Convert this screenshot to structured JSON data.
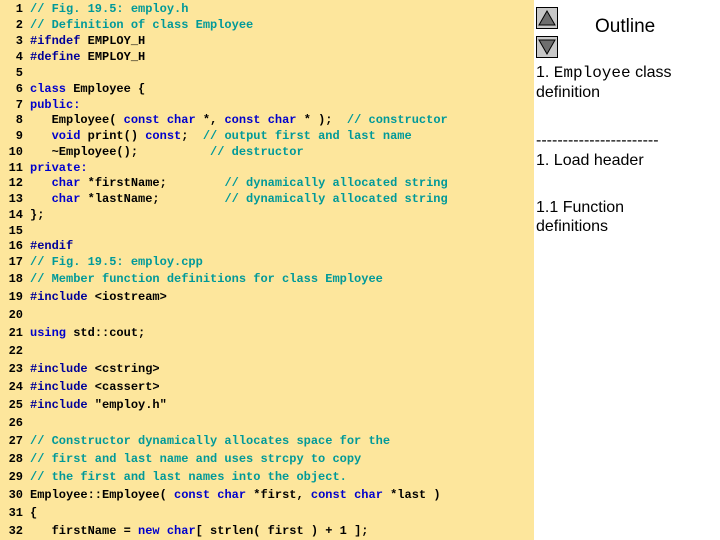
{
  "colors": {
    "code_background": "#fde69c",
    "keyword": "#0000cc",
    "comment": "#009999",
    "plain": "#000000",
    "preprocessor": "#000099",
    "line_number": "#000000"
  },
  "code_lines": [
    {
      "num": "1",
      "segments": [
        {
          "t": "// Fig. 19.5: employ.h",
          "c": "comment"
        }
      ]
    },
    {
      "num": "2",
      "segments": [
        {
          "t": "// Definition of class Employee",
          "c": "comment"
        }
      ]
    },
    {
      "num": "3",
      "segments": [
        {
          "t": "#ifndef",
          "c": "preprocessor"
        },
        {
          "t": " EMPLOY_H",
          "c": "plain"
        }
      ]
    },
    {
      "num": "4",
      "segments": [
        {
          "t": "#define",
          "c": "preprocessor"
        },
        {
          "t": " EMPLOY_H",
          "c": "plain"
        }
      ]
    },
    {
      "num": "5",
      "segments": []
    },
    {
      "num": "6",
      "segments": [
        {
          "t": "class",
          "c": "keyword"
        },
        {
          "t": " Employee {",
          "c": "plain"
        }
      ]
    },
    {
      "num": "7",
      "segments": [
        {
          "t": "public:",
          "c": "keyword"
        }
      ]
    },
    {
      "num": "8",
      "segments": [
        {
          "t": "   Employee( ",
          "c": "plain"
        },
        {
          "t": "const",
          "c": "keyword"
        },
        {
          "t": " ",
          "c": "plain"
        },
        {
          "t": "char",
          "c": "keyword"
        },
        {
          "t": " *, ",
          "c": "plain"
        },
        {
          "t": "const",
          "c": "keyword"
        },
        {
          "t": " ",
          "c": "plain"
        },
        {
          "t": "char",
          "c": "keyword"
        },
        {
          "t": " * );  ",
          "c": "plain"
        },
        {
          "t": "// constructor",
          "c": "comment"
        }
      ]
    },
    {
      "num": "9",
      "segments": [
        {
          "t": "   ",
          "c": "plain"
        },
        {
          "t": "void",
          "c": "keyword"
        },
        {
          "t": " print() ",
          "c": "plain"
        },
        {
          "t": "const",
          "c": "keyword"
        },
        {
          "t": ";  ",
          "c": "plain"
        },
        {
          "t": "// output first and last name",
          "c": "comment"
        }
      ]
    },
    {
      "num": "10",
      "segments": [
        {
          "t": "   ~Employee();          ",
          "c": "plain"
        },
        {
          "t": "// destructor",
          "c": "comment"
        }
      ]
    },
    {
      "num": "11",
      "segments": [
        {
          "t": "private:",
          "c": "keyword"
        }
      ]
    },
    {
      "num": "12",
      "segments": [
        {
          "t": "   ",
          "c": "plain"
        },
        {
          "t": "char",
          "c": "keyword"
        },
        {
          "t": " *firstName;        ",
          "c": "plain"
        },
        {
          "t": "// dynamically allocated string",
          "c": "comment"
        }
      ]
    },
    {
      "num": "13",
      "segments": [
        {
          "t": "   ",
          "c": "plain"
        },
        {
          "t": "char",
          "c": "keyword"
        },
        {
          "t": " *lastName;         ",
          "c": "plain"
        },
        {
          "t": "// dynamically allocated string",
          "c": "comment"
        }
      ]
    },
    {
      "num": "14",
      "segments": [
        {
          "t": "};",
          "c": "plain"
        }
      ]
    },
    {
      "num": "15",
      "segments": []
    },
    {
      "num": "16",
      "segments": [
        {
          "t": "#endif",
          "c": "preprocessor"
        }
      ]
    },
    {
      "num": "17",
      "segments": [
        {
          "t": "// Fig. 19.5: employ.cpp",
          "c": "comment"
        }
      ]
    },
    {
      "num": "18",
      "segments": [
        {
          "t": "// Member function definitions for class Employee",
          "c": "comment"
        }
      ]
    },
    {
      "num": "19",
      "segments": [
        {
          "t": "#include",
          "c": "preprocessor"
        },
        {
          "t": " <iostream>",
          "c": "plain"
        }
      ]
    },
    {
      "num": "20",
      "segments": []
    },
    {
      "num": "21",
      "segments": [
        {
          "t": "using",
          "c": "keyword"
        },
        {
          "t": " std::cout;",
          "c": "plain"
        }
      ]
    },
    {
      "num": "22",
      "segments": []
    },
    {
      "num": "23",
      "segments": [
        {
          "t": "#include",
          "c": "preprocessor"
        },
        {
          "t": " <cstring>",
          "c": "plain"
        }
      ]
    },
    {
      "num": "24",
      "segments": [
        {
          "t": "#include",
          "c": "preprocessor"
        },
        {
          "t": " <cassert>",
          "c": "plain"
        }
      ]
    },
    {
      "num": "25",
      "segments": [
        {
          "t": "#include",
          "c": "preprocessor"
        },
        {
          "t": " \"employ.h\"",
          "c": "plain"
        }
      ]
    },
    {
      "num": "26",
      "segments": []
    },
    {
      "num": "27",
      "segments": [
        {
          "t": "// Constructor dynamically allocates space for the",
          "c": "comment"
        }
      ]
    },
    {
      "num": "28",
      "segments": [
        {
          "t": "// first and last name and uses strcpy to copy",
          "c": "comment"
        }
      ]
    },
    {
      "num": "29",
      "segments": [
        {
          "t": "// the first and last names into the object.",
          "c": "comment"
        }
      ]
    },
    {
      "num": "30",
      "segments": [
        {
          "t": "Employee::Employee( ",
          "c": "plain"
        },
        {
          "t": "const",
          "c": "keyword"
        },
        {
          "t": " ",
          "c": "plain"
        },
        {
          "t": "char",
          "c": "keyword"
        },
        {
          "t": " *first, ",
          "c": "plain"
        },
        {
          "t": "const",
          "c": "keyword"
        },
        {
          "t": " ",
          "c": "plain"
        },
        {
          "t": "char",
          "c": "keyword"
        },
        {
          "t": " *last )",
          "c": "plain"
        }
      ]
    },
    {
      "num": "31",
      "segments": [
        {
          "t": "{",
          "c": "plain"
        }
      ]
    },
    {
      "num": "32",
      "segments": [
        {
          "t": "   firstName = ",
          "c": "plain"
        },
        {
          "t": "new",
          "c": "keyword"
        },
        {
          "t": " ",
          "c": "plain"
        },
        {
          "t": "char",
          "c": "keyword"
        },
        {
          "t": "[ strlen( first ) + 1 ];",
          "c": "plain"
        }
      ]
    }
  ],
  "sidebar": {
    "up_icon": "triangle-up-icon",
    "down_icon": "triangle-down-icon",
    "title": "Outline",
    "item1_num": "1.",
    "item1_code": "Employee",
    "item1_text": "class definition",
    "separator": "-----------------------",
    "item2": "1. Load header",
    "item3": "1.1 Function definitions"
  }
}
